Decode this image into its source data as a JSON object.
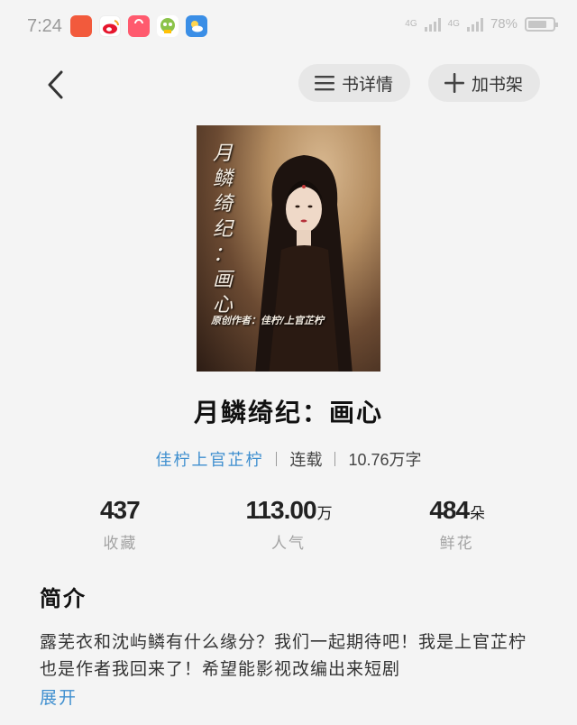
{
  "status_bar": {
    "time": "7:24",
    "battery": "78%",
    "battery_level": 0.78,
    "net_1": "4G",
    "net_2": "4G",
    "app_icons": [
      "red-app-icon",
      "weibo-icon",
      "shopping-bag-icon",
      "green-app-icon",
      "weather-icon"
    ]
  },
  "header": {
    "back_icon": "chevron-left-icon",
    "details_label": "书详情",
    "add_shelf_label": "加书架"
  },
  "book": {
    "cover_title": "月 鳞 绮 纪 ： 画 心",
    "cover_author": "原创作者：佳柠/上官芷柠",
    "title": "月鳞绮纪：画心",
    "author": "佳柠上官芷柠",
    "status": "连载",
    "word_count": "10.76万字"
  },
  "stats": [
    {
      "value": "437",
      "unit": "",
      "label": "收藏"
    },
    {
      "value": "113.00",
      "unit": "万",
      "label": "人气"
    },
    {
      "value": "484",
      "unit": "朵",
      "label": "鲜花"
    }
  ],
  "intro": {
    "heading": "简介",
    "text": "露芜衣和沈屿鳞有什么缘分？我们一起期待吧！我是上官芷柠也是作者我回来了！希望能影视改编出来短剧",
    "expand_label": "展开"
  }
}
